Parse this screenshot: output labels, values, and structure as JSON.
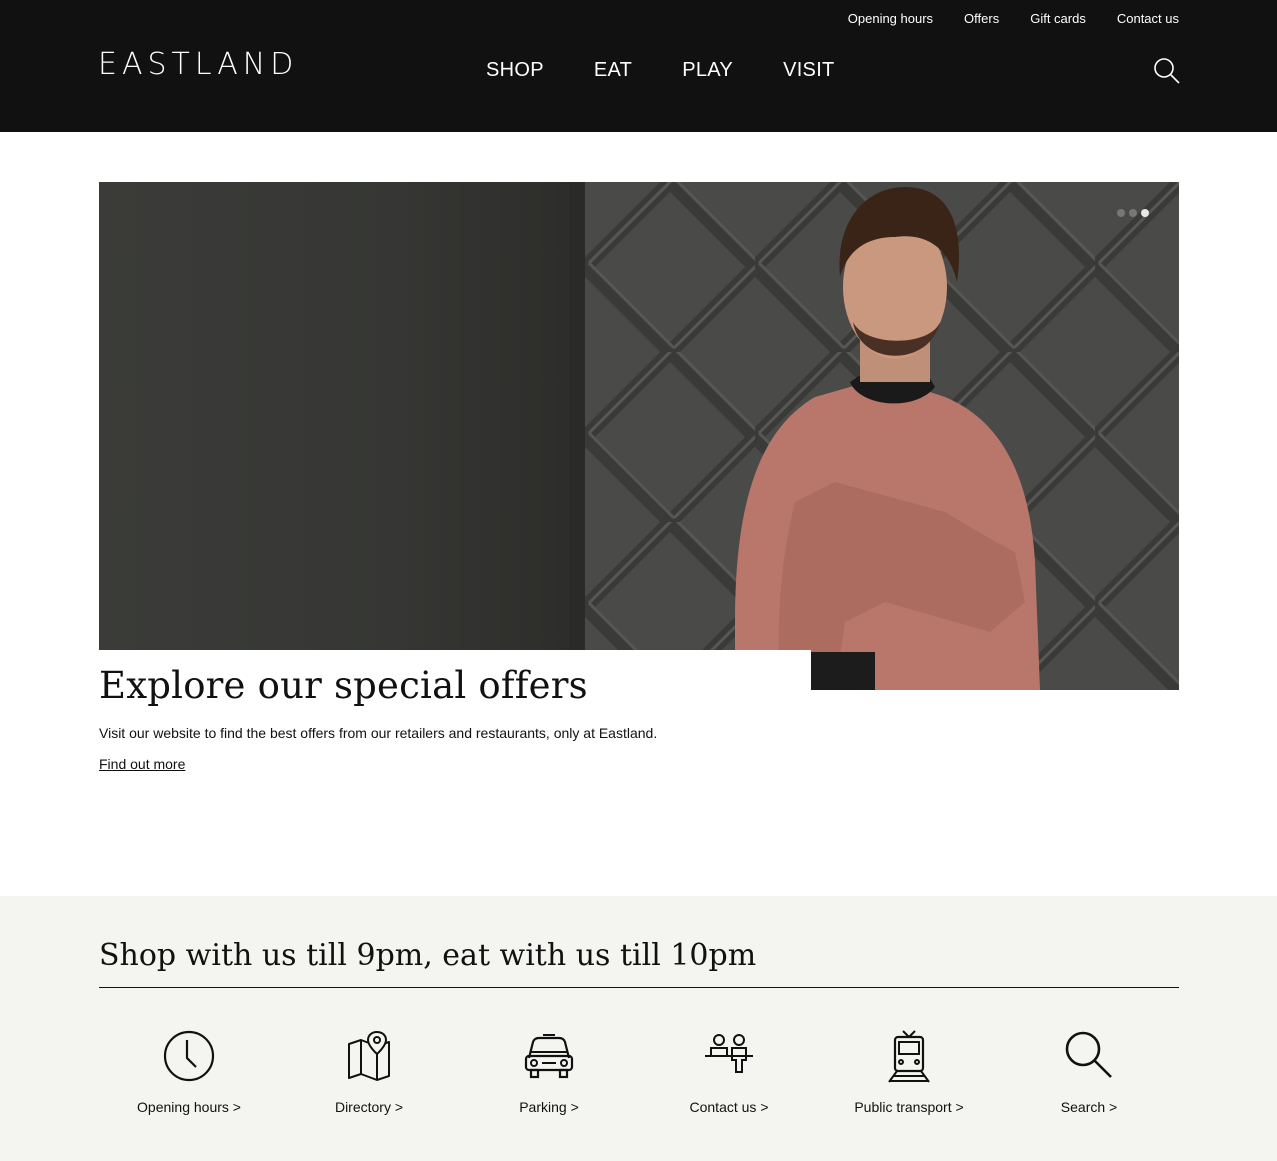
{
  "utility_nav": [
    "Opening hours",
    "Offers",
    "Gift cards",
    "Contact us"
  ],
  "logo": "EASTLAND",
  "main_nav": [
    "SHOP",
    "EAT",
    "PLAY",
    "VISIT"
  ],
  "hero": {
    "title": "Explore our special offers",
    "description": "Visit our website to find the best offers from our retailers and restaurants, only at Eastland.",
    "link": "Find out more",
    "slides": 3,
    "active_slide": 3
  },
  "info": {
    "title": "Shop with us till 9pm, eat with us till 10pm",
    "links": [
      {
        "label": "Opening hours >",
        "icon": "clock-icon"
      },
      {
        "label": "Directory >",
        "icon": "map-icon"
      },
      {
        "label": "Parking >",
        "icon": "car-icon"
      },
      {
        "label": "Contact us >",
        "icon": "contact-icon"
      },
      {
        "label": "Public transport >",
        "icon": "train-icon"
      },
      {
        "label": "Search >",
        "icon": "search-icon"
      }
    ]
  },
  "colors": {
    "header_bg": "#111111",
    "info_bg": "#f4f4f0",
    "sweater": "#b8776a"
  }
}
